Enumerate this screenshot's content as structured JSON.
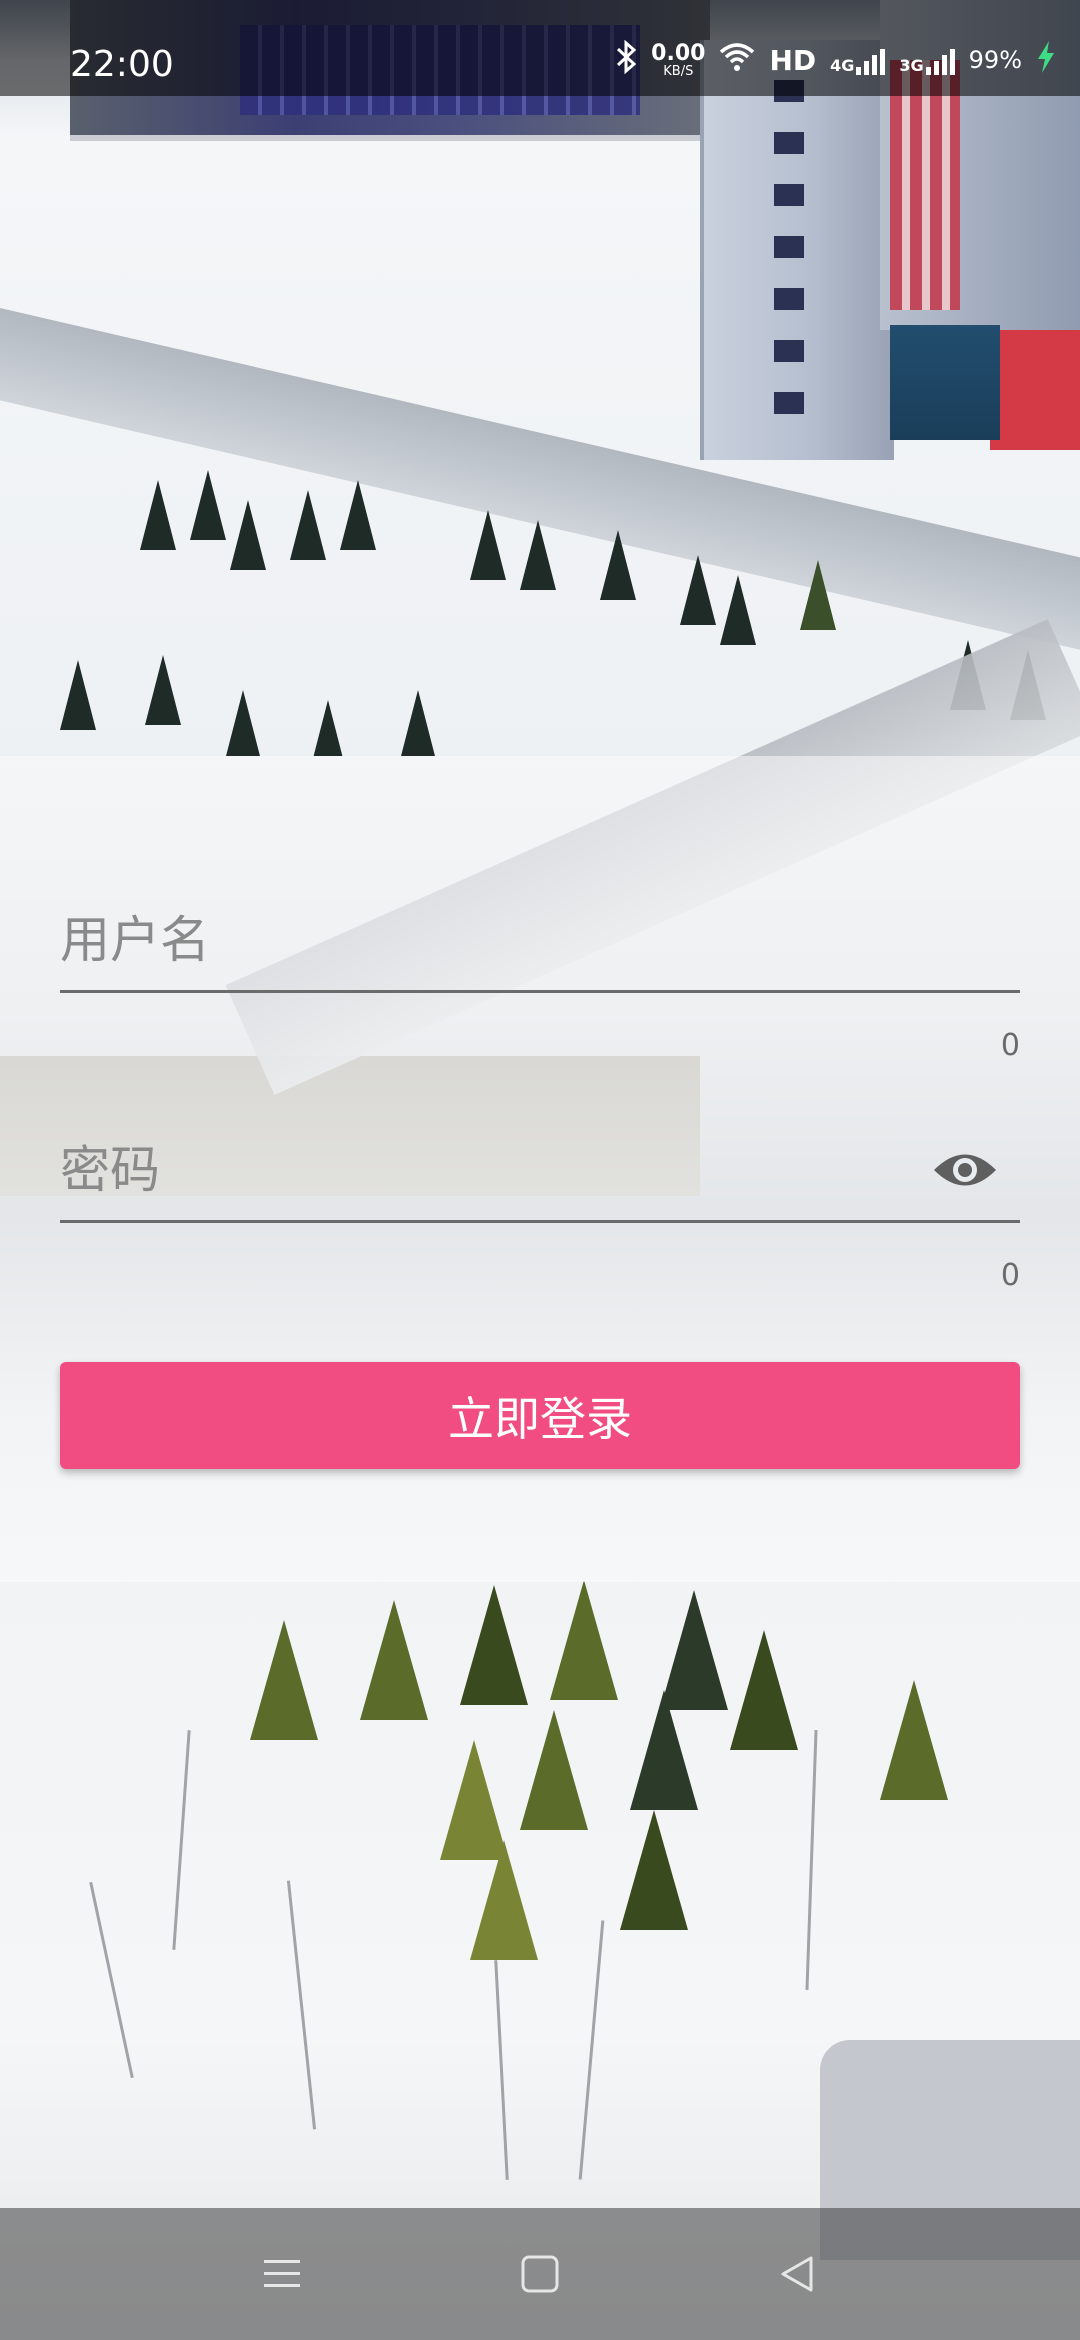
{
  "status_bar": {
    "time": "22:00",
    "net_speed_value": "0.00",
    "net_speed_unit": "KB/S",
    "hd_label": "HD",
    "network_4g": "4G",
    "network_3g": "3G",
    "battery_percent": "99%"
  },
  "login": {
    "username_placeholder": "用户名",
    "username_counter": "0",
    "password_placeholder": "密码",
    "password_counter": "0",
    "submit_label": "立即登录"
  },
  "icons": {
    "bluetooth": "bluetooth-icon",
    "wifi": "wifi-icon",
    "signal": "signal-icon",
    "charging": "charging-bolt-icon",
    "visibility": "eye-icon",
    "nav_menu": "menu-icon",
    "nav_home": "home-square-icon",
    "nav_back": "back-triangle-icon"
  },
  "colors": {
    "accent": "#f24d82",
    "status_bar_bg": "#000000",
    "charging": "#3ddc84"
  }
}
